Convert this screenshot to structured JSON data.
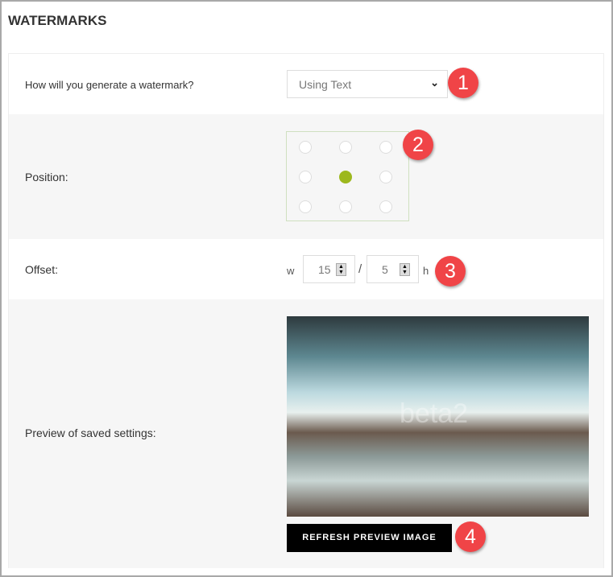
{
  "title": "WATERMARKS",
  "generate": {
    "label": "How will you generate a watermark?",
    "value": "Using Text"
  },
  "position": {
    "label": "Position:",
    "selected": "center",
    "options": [
      "top-left",
      "top-center",
      "top-right",
      "middle-left",
      "center",
      "middle-right",
      "bottom-left",
      "bottom-center",
      "bottom-right"
    ]
  },
  "offset": {
    "label": "Offset:",
    "w_label": "w",
    "w_value": "15",
    "separator": "/",
    "h_value": "5",
    "h_label": "h"
  },
  "preview": {
    "label": "Preview of saved settings:",
    "watermark_text": "beta2",
    "button": "REFRESH PREVIEW IMAGE"
  },
  "badges": [
    "1",
    "2",
    "3",
    "4"
  ],
  "colors": {
    "accent": "#9db81e",
    "badge": "#f04447"
  }
}
